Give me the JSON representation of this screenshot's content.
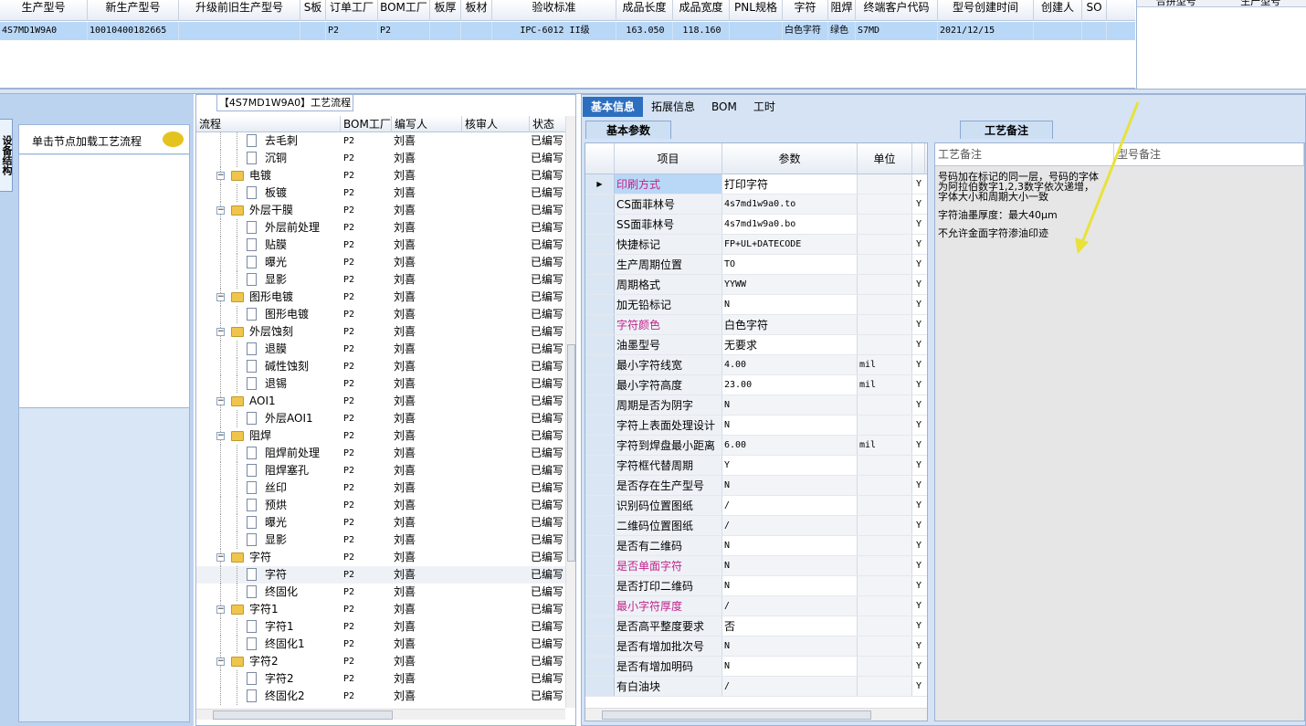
{
  "top_grid": {
    "headers": [
      "生产型号",
      "新生产型号",
      "升级前旧生产型号",
      "S板",
      "订单工厂",
      "BOM工厂",
      "板厚",
      "板材",
      "验收标准",
      "成品长度",
      "成品宽度",
      "PNL规格",
      "字符",
      "阻焊",
      "终端客户代码",
      "型号创建时间",
      "创建人",
      "SO"
    ],
    "row": [
      "4S7MD1W9A0",
      "10010400182665",
      "",
      "",
      "P2",
      "P2",
      "",
      "",
      "IPC-6012 II级",
      "163.050",
      "118.160",
      "",
      "白色字符",
      "绿色",
      "S7MD",
      "2021/12/15",
      "",
      ""
    ],
    "right_headers": [
      "合拼型号",
      "生产型号"
    ]
  },
  "left": {
    "vtab_label": "设备结构",
    "hint": "单击节点加载工艺流程"
  },
  "center": {
    "title": "【4S7MD1W9A0】工艺流程",
    "headers": [
      "流程",
      "BOM工厂",
      "编写人",
      "核审人",
      "状态"
    ],
    "rows": [
      {
        "label": "去毛刺",
        "level": 1,
        "type": "doc",
        "bom": "P2",
        "writer": "刘喜",
        "reviewer": "",
        "status": "已编写"
      },
      {
        "label": "沉铜",
        "level": 1,
        "type": "doc",
        "bom": "P2",
        "writer": "刘喜",
        "reviewer": "",
        "status": "已编写"
      },
      {
        "label": "电镀",
        "level": 0,
        "type": "folder",
        "bom": "P2",
        "writer": "刘喜",
        "reviewer": "",
        "status": "已编写"
      },
      {
        "label": "板镀",
        "level": 1,
        "type": "doc",
        "bom": "P2",
        "writer": "刘喜",
        "reviewer": "",
        "status": "已编写"
      },
      {
        "label": "外层干膜",
        "level": 0,
        "type": "folder",
        "bom": "P2",
        "writer": "刘喜",
        "reviewer": "",
        "status": "已编写"
      },
      {
        "label": "外层前处理",
        "level": 1,
        "type": "doc",
        "bom": "P2",
        "writer": "刘喜",
        "reviewer": "",
        "status": "已编写"
      },
      {
        "label": "贴膜",
        "level": 1,
        "type": "doc",
        "bom": "P2",
        "writer": "刘喜",
        "reviewer": "",
        "status": "已编写"
      },
      {
        "label": "曝光",
        "level": 1,
        "type": "doc",
        "bom": "P2",
        "writer": "刘喜",
        "reviewer": "",
        "status": "已编写"
      },
      {
        "label": "显影",
        "level": 1,
        "type": "doc",
        "bom": "P2",
        "writer": "刘喜",
        "reviewer": "",
        "status": "已编写"
      },
      {
        "label": "图形电镀",
        "level": 0,
        "type": "folder",
        "bom": "P2",
        "writer": "刘喜",
        "reviewer": "",
        "status": "已编写"
      },
      {
        "label": "图形电镀",
        "level": 1,
        "type": "doc",
        "bom": "P2",
        "writer": "刘喜",
        "reviewer": "",
        "status": "已编写"
      },
      {
        "label": "外层蚀刻",
        "level": 0,
        "type": "folder",
        "bom": "P2",
        "writer": "刘喜",
        "reviewer": "",
        "status": "已编写"
      },
      {
        "label": "退膜",
        "level": 1,
        "type": "doc",
        "bom": "P2",
        "writer": "刘喜",
        "reviewer": "",
        "status": "已编写"
      },
      {
        "label": "碱性蚀刻",
        "level": 1,
        "type": "doc",
        "bom": "P2",
        "writer": "刘喜",
        "reviewer": "",
        "status": "已编写"
      },
      {
        "label": "退锡",
        "level": 1,
        "type": "doc",
        "bom": "P2",
        "writer": "刘喜",
        "reviewer": "",
        "status": "已编写"
      },
      {
        "label": "AOI1",
        "level": 0,
        "type": "folder",
        "bom": "P2",
        "writer": "刘喜",
        "reviewer": "",
        "status": "已编写"
      },
      {
        "label": "外层AOI1",
        "level": 1,
        "type": "doc",
        "bom": "P2",
        "writer": "刘喜",
        "reviewer": "",
        "status": "已编写"
      },
      {
        "label": "阻焊",
        "level": 0,
        "type": "folder",
        "bom": "P2",
        "writer": "刘喜",
        "reviewer": "",
        "status": "已编写"
      },
      {
        "label": "阻焊前处理",
        "level": 1,
        "type": "doc",
        "bom": "P2",
        "writer": "刘喜",
        "reviewer": "",
        "status": "已编写"
      },
      {
        "label": "阻焊塞孔",
        "level": 1,
        "type": "doc",
        "bom": "P2",
        "writer": "刘喜",
        "reviewer": "",
        "status": "已编写"
      },
      {
        "label": "丝印",
        "level": 1,
        "type": "doc",
        "bom": "P2",
        "writer": "刘喜",
        "reviewer": "",
        "status": "已编写"
      },
      {
        "label": "预烘",
        "level": 1,
        "type": "doc",
        "bom": "P2",
        "writer": "刘喜",
        "reviewer": "",
        "status": "已编写"
      },
      {
        "label": "曝光",
        "level": 1,
        "type": "doc",
        "bom": "P2",
        "writer": "刘喜",
        "reviewer": "",
        "status": "已编写"
      },
      {
        "label": "显影",
        "level": 1,
        "type": "doc",
        "bom": "P2",
        "writer": "刘喜",
        "reviewer": "",
        "status": "已编写"
      },
      {
        "label": "字符",
        "level": 0,
        "type": "folder",
        "bom": "P2",
        "writer": "刘喜",
        "reviewer": "",
        "status": "已编写"
      },
      {
        "label": "字符",
        "level": 1,
        "type": "doc",
        "bom": "P2",
        "writer": "刘喜",
        "reviewer": "",
        "status": "已编写",
        "selected": true
      },
      {
        "label": "终固化",
        "level": 1,
        "type": "doc",
        "bom": "P2",
        "writer": "刘喜",
        "reviewer": "",
        "status": "已编写"
      },
      {
        "label": "字符1",
        "level": 0,
        "type": "folder",
        "bom": "P2",
        "writer": "刘喜",
        "reviewer": "",
        "status": "已编写"
      },
      {
        "label": "字符1",
        "level": 1,
        "type": "doc",
        "bom": "P2",
        "writer": "刘喜",
        "reviewer": "",
        "status": "已编写"
      },
      {
        "label": "终固化1",
        "level": 1,
        "type": "doc",
        "bom": "P2",
        "writer": "刘喜",
        "reviewer": "",
        "status": "已编写"
      },
      {
        "label": "字符2",
        "level": 0,
        "type": "folder",
        "bom": "P2",
        "writer": "刘喜",
        "reviewer": "",
        "status": "已编写"
      },
      {
        "label": "字符2",
        "level": 1,
        "type": "doc",
        "bom": "P2",
        "writer": "刘喜",
        "reviewer": "",
        "status": "已编写"
      },
      {
        "label": "终固化2",
        "level": 1,
        "type": "doc",
        "bom": "P2",
        "writer": "刘喜",
        "reviewer": "",
        "status": "已编写"
      }
    ]
  },
  "right": {
    "tabs": [
      "基本信息",
      "拓展信息",
      "BOM",
      "工时"
    ],
    "active_tab": 0,
    "params_title": "基本参数",
    "params_headers": [
      "项目",
      "参数",
      "单位"
    ],
    "params": [
      {
        "name": "印刷方式",
        "value": "打印字符",
        "unit": "",
        "flag": "Y",
        "pink": true,
        "current": true
      },
      {
        "name": "CS面菲林号",
        "value": "4s7md1w9a0.to",
        "unit": "",
        "flag": "Y"
      },
      {
        "name": "SS面菲林号",
        "value": "4s7md1w9a0.bo",
        "unit": "",
        "flag": "Y"
      },
      {
        "name": "快捷标记",
        "value": "FP+UL+DATECODE",
        "unit": "",
        "flag": "Y"
      },
      {
        "name": "生产周期位置",
        "value": "TO",
        "unit": "",
        "flag": "Y"
      },
      {
        "name": "周期格式",
        "value": "YYWW",
        "unit": "",
        "flag": "Y"
      },
      {
        "name": "加无铅标记",
        "value": "N",
        "unit": "",
        "flag": "Y"
      },
      {
        "name": "字符颜色",
        "value": "白色字符",
        "unit": "",
        "flag": "Y",
        "pink": true
      },
      {
        "name": "油墨型号",
        "value": "无要求",
        "unit": "",
        "flag": "Y"
      },
      {
        "name": "最小字符线宽",
        "value": "4.00",
        "unit": "mil",
        "flag": "Y"
      },
      {
        "name": "最小字符高度",
        "value": "23.00",
        "unit": "mil",
        "flag": "Y"
      },
      {
        "name": "周期是否为阴字",
        "value": "N",
        "unit": "",
        "flag": "Y"
      },
      {
        "name": "字符上表面处理设计",
        "value": "N",
        "unit": "",
        "flag": "Y"
      },
      {
        "name": "字符到焊盘最小距离",
        "value": "6.00",
        "unit": "mil",
        "flag": "Y"
      },
      {
        "name": "字符框代替周期",
        "value": "Y",
        "unit": "",
        "flag": "Y"
      },
      {
        "name": "是否存在生产型号",
        "value": "N",
        "unit": "",
        "flag": "Y"
      },
      {
        "name": "识别码位置图纸",
        "value": "/",
        "unit": "",
        "flag": "Y"
      },
      {
        "name": "二维码位置图纸",
        "value": "/",
        "unit": "",
        "flag": "Y"
      },
      {
        "name": "是否有二维码",
        "value": "N",
        "unit": "",
        "flag": "Y"
      },
      {
        "name": "是否单面字符",
        "value": "N",
        "unit": "",
        "flag": "Y",
        "pink": true
      },
      {
        "name": "是否打印二维码",
        "value": "N",
        "unit": "",
        "flag": "Y"
      },
      {
        "name": "最小字符厚度",
        "value": "/",
        "unit": "",
        "flag": "Y",
        "pink": true
      },
      {
        "name": "是否高平整度要求",
        "value": "否",
        "unit": "",
        "flag": "Y"
      },
      {
        "name": "是否有增加批次号",
        "value": "N",
        "unit": "",
        "flag": "Y"
      },
      {
        "name": "是否有增加明码",
        "value": "N",
        "unit": "",
        "flag": "Y"
      },
      {
        "name": "有白油块",
        "value": "/",
        "unit": "",
        "flag": "Y"
      }
    ],
    "notes_title": "工艺备注",
    "notes_headers": [
      "工艺备注",
      "型号备注"
    ],
    "notes": [
      "号码加在标记的同一层，号码的字体为阿拉伯数字1,2,3数字依次递增，字体大小和周期大小一致",
      "字符油墨厚度：最大40μm",
      "不允许金面字符渗油印迹"
    ],
    "arrow_color": "#e8e23a"
  }
}
